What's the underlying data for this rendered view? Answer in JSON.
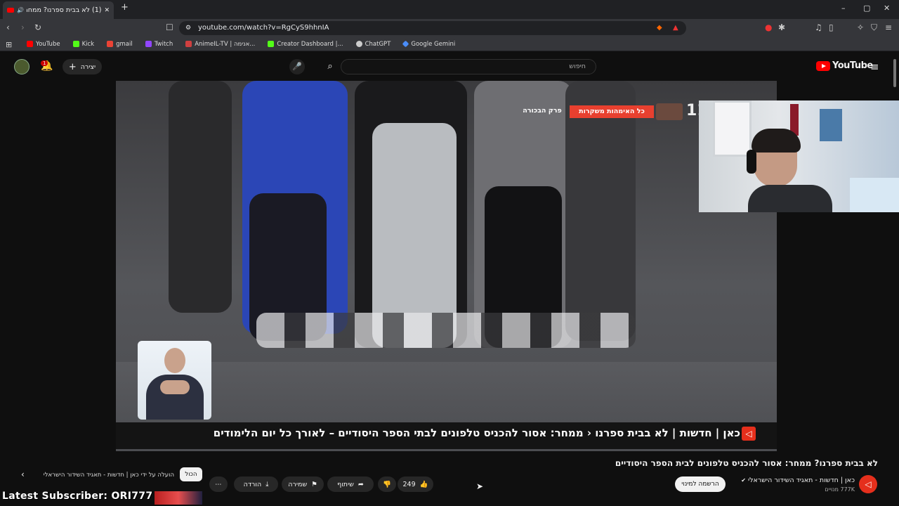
{
  "browser": {
    "tab_title": "(1) לא בבית ספרנו? ממחר: א",
    "url": "youtube.com/watch?v=RgCyS9hhnIA",
    "new_tab": "+",
    "window_controls": [
      "–",
      "▢",
      "✕"
    ],
    "bookmarks": [
      {
        "label": "YouTube",
        "color": "#ff0000"
      },
      {
        "label": "Kick",
        "color": "#53fc18"
      },
      {
        "label": "gmail",
        "color": "#ea4335"
      },
      {
        "label": "Twitch",
        "color": "#9146ff"
      },
      {
        "label": "AnimeIL-TV | אנימה...",
        "color": "#d04040"
      },
      {
        "label": "Creator Dashboard |...",
        "color": "#53fc18"
      },
      {
        "label": "ChatGPT",
        "color": "#cccccc"
      },
      {
        "label": "Google Gemini",
        "color": "#4a8df8"
      }
    ]
  },
  "youtube": {
    "logo_text": "YouTube",
    "search_placeholder": "חיפוש",
    "create_label": "יצירה",
    "notification_count": "1"
  },
  "video": {
    "ticker_text": "כאן | חדשות  |  לא בבית ספרנו ‹ ממחר: אסור להכניס טלפונים לבתי הספר היסודיים – לאורך כל יום הלימודים",
    "promo_text": "כל האימהות משקרות",
    "promo_sub": "פרק הבכורה",
    "channel_number": "11"
  },
  "meta": {
    "title": "לא בבית ספרנו? ממחר: אסור להכניס טלפונים לבית הספר היסודיים",
    "channel": "כאן | חדשות - תאגיד השידור הישראלי",
    "verified": "✔",
    "subscribers": "777K מנויים",
    "subscribe_label": "הרשמה למינוי",
    "like_count": "249",
    "share_label": "שיתוף",
    "save_label": "שמירה",
    "download_label": "הורדה",
    "more_label": "⋯"
  },
  "chips": {
    "all_label": "הכול",
    "uploaded_label": "הועלה על ידי כאן | חדשות - תאגיד השידור הישראלי"
  },
  "overlay": {
    "latest_subscriber": "Latest Subscriber: ORI777"
  }
}
